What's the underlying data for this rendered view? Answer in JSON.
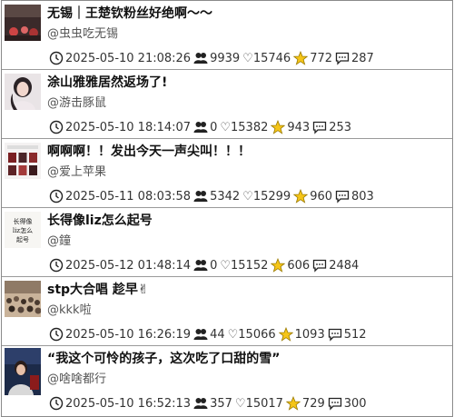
{
  "posts": [
    {
      "title": "无锡｜王楚钦粉丝好绝啊～～",
      "author": "@虫虫吃无锡",
      "time": "2025-05-10 21:08:26",
      "views": "9939",
      "likes": "15746",
      "stars": "772",
      "comments": "287",
      "heart": "♡"
    },
    {
      "title": "涂山雅雅居然返场了!",
      "author": "@游击豚鼠",
      "time": "2025-05-10 18:14:07",
      "views": "0",
      "likes": "15382",
      "stars": "943",
      "comments": "253",
      "heart": "♡"
    },
    {
      "title": "啊啊啊！！发出今天一声尖叫！！！",
      "author": "@爱上苹果",
      "time": "2025-05-11 08:03:58",
      "views": "5342",
      "likes": "15299",
      "stars": "960",
      "comments": "803",
      "heart": "♡"
    },
    {
      "title": "长得像liz怎么起号",
      "author": "@鐘",
      "time": "2025-05-12 01:48:14",
      "views": "0",
      "likes": "15152",
      "stars": "606",
      "comments": "2484",
      "heart": "♡"
    },
    {
      "title": "stp大合唱 趁早✌",
      "author": "@kkk啦",
      "time": "2025-05-10 16:26:19",
      "views": "44",
      "likes": "15066",
      "stars": "1093",
      "comments": "512",
      "heart": "♡"
    },
    {
      "title": "“我这个可怜的孩子，这次吃了口甜的雪”",
      "author": "@啥啥都行",
      "time": "2025-05-10 16:52:13",
      "views": "357",
      "likes": "15017",
      "stars": "729",
      "comments": "300",
      "heart": "♡"
    }
  ],
  "thumb4_text": "长得像\nliz怎么\n起号",
  "icons": {
    "time": "clock-icon",
    "views": "people-icon",
    "likes": "heart-icon",
    "stars": "star-icon",
    "comments": "comment-icon"
  }
}
